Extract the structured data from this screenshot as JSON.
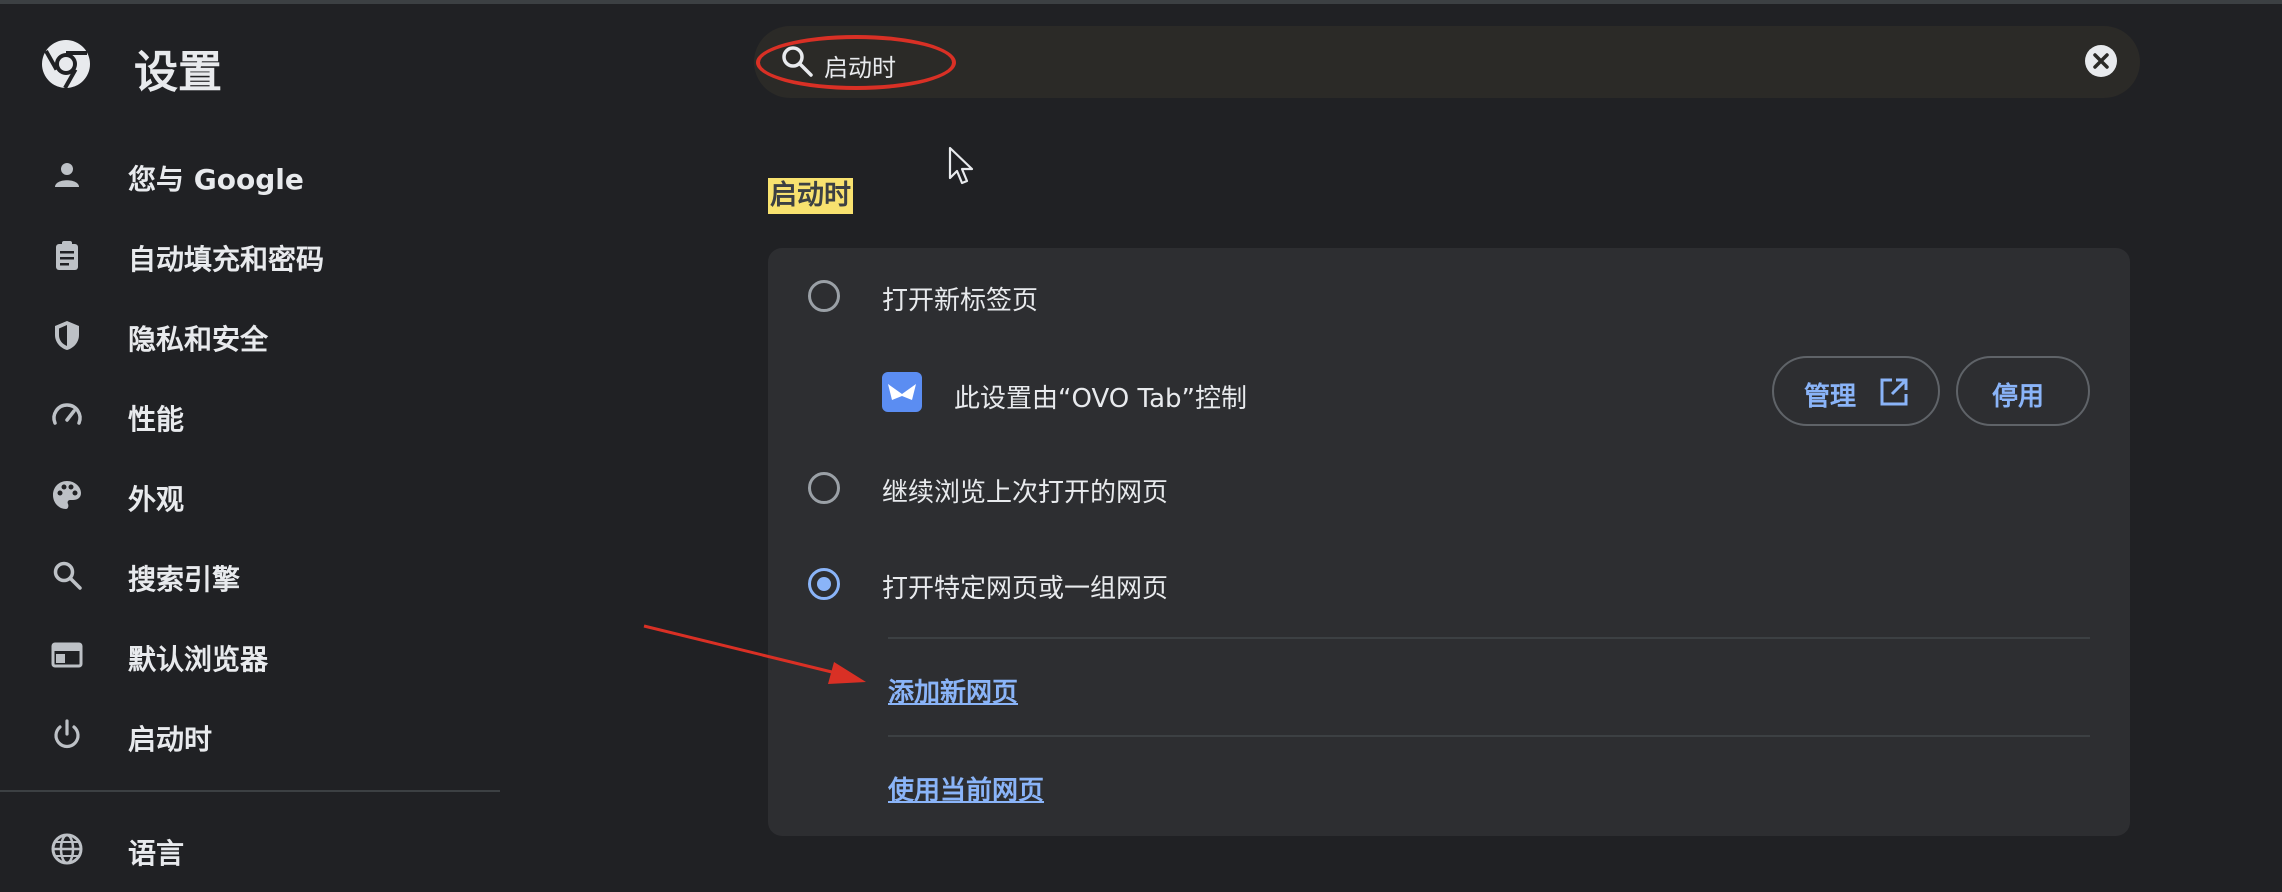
{
  "header": {
    "title": "设置"
  },
  "search": {
    "value": "启动时"
  },
  "sidebar": {
    "items": [
      {
        "label": "您与 Google",
        "icon": "person-icon"
      },
      {
        "label": "自动填充和密码",
        "icon": "clipboard-icon"
      },
      {
        "label": "隐私和安全",
        "icon": "shield-icon"
      },
      {
        "label": "性能",
        "icon": "speedometer-icon"
      },
      {
        "label": "外观",
        "icon": "palette-icon"
      },
      {
        "label": "搜索引擎",
        "icon": "search-icon"
      },
      {
        "label": "默认浏览器",
        "icon": "browser-window-icon"
      },
      {
        "label": "启动时",
        "icon": "power-icon"
      },
      {
        "label": "语言",
        "icon": "globe-icon"
      }
    ]
  },
  "main": {
    "section_heading": "启动时",
    "options": [
      {
        "label": "打开新标签页",
        "checked": false
      },
      {
        "label": "继续浏览上次打开的网页",
        "checked": false
      },
      {
        "label": "打开特定网页或一组网页",
        "checked": true
      }
    ],
    "extension_notice": {
      "text": "此设置由“OVO Tab”控制",
      "manage_label": "管理",
      "disable_label": "停用"
    },
    "links": {
      "add_page": "添加新网页",
      "use_current": "使用当前网页"
    }
  },
  "colors": {
    "background": "#202124",
    "card": "#2d2e31",
    "accent": "#8ab4f8",
    "highlight": "#f8e26f",
    "annotation": "#d93025"
  }
}
